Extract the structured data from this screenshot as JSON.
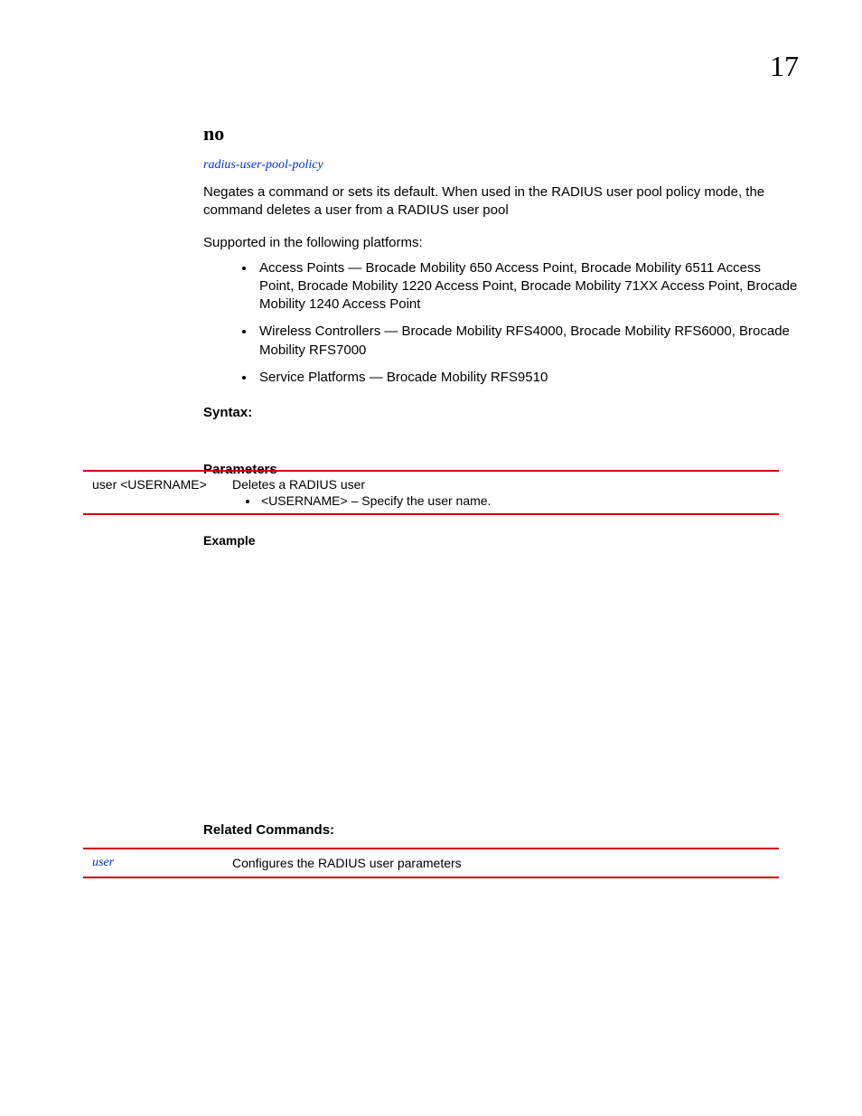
{
  "page_number": "17",
  "command": {
    "title": "no",
    "link_text": "radius-user-pool-policy",
    "description": "Negates a command or sets its default. When used in the RADIUS user pool policy mode, the command deletes a user from a RADIUS user pool",
    "supported_intro": "Supported in the following platforms:",
    "platforms": [
      "Access Points — Brocade Mobility 650 Access Point, Brocade Mobility 6511 Access Point, Brocade Mobility 1220 Access Point, Brocade Mobility 71XX Access Point, Brocade Mobility 1240 Access Point",
      "Wireless Controllers — Brocade Mobility RFS4000, Brocade Mobility RFS6000, Brocade Mobility RFS7000",
      "Service Platforms — Brocade Mobility RFS9510"
    ],
    "syntax_label": "Syntax:",
    "parameters_label": "Parameters",
    "param_row": {
      "left": "user <USERNAME>",
      "right_main": "Deletes a RADIUS user",
      "right_bullet": "<USERNAME> – Specify the user name."
    },
    "example_label": "Example",
    "related_label": "Related Commands:",
    "related_row": {
      "left": "user",
      "right": "Configures the RADIUS user parameters"
    }
  }
}
